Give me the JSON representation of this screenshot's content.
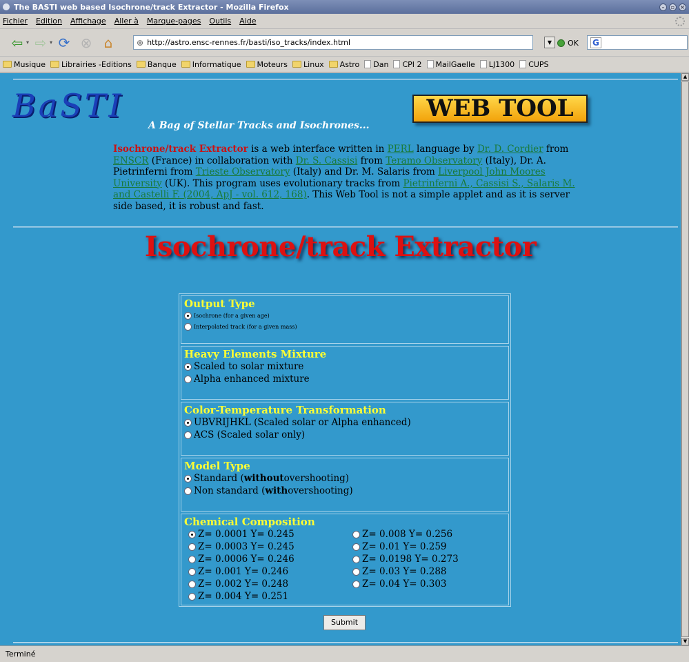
{
  "window": {
    "title": "The BASTI web based Isochrone/track Extractor - Mozilla Firefox"
  },
  "menu": [
    "Fichier",
    "Edition",
    "Affichage",
    "Aller à",
    "Marque-pages",
    "Outils",
    "Aide"
  ],
  "toolbar": {
    "url": "http://astro.ensc-rennes.fr/basti/iso_tracks/index.html",
    "ok_label": "OK"
  },
  "bookmarks": [
    {
      "label": "Musique",
      "icon": "folder-icon"
    },
    {
      "label": "Librairies -Editions",
      "icon": "folder-icon"
    },
    {
      "label": "Banque",
      "icon": "folder-icon"
    },
    {
      "label": "Informatique",
      "icon": "folder-icon"
    },
    {
      "label": "Moteurs",
      "icon": "folder-icon"
    },
    {
      "label": "Linux",
      "icon": "folder-icon"
    },
    {
      "label": "Astro",
      "icon": "folder-icon"
    },
    {
      "label": "Dan",
      "icon": "page-icon"
    },
    {
      "label": "CPI 2",
      "icon": "page-icon"
    },
    {
      "label": "MailGaelle",
      "icon": "page-icon"
    },
    {
      "label": "LJ1300",
      "icon": "page-icon"
    },
    {
      "label": "CUPS",
      "icon": "page-icon"
    }
  ],
  "page": {
    "logo": "BaSTI",
    "tagline": "A Bag of Stellar Tracks and Isochrones...",
    "web_tool": "WEB TOOL",
    "intro": {
      "title": "Isochrone/track Extractor",
      "t1": " is a web interface written in ",
      "l1": "PERL",
      "t2": " language by ",
      "l2": "Dr. D. Cordier",
      "t3": " from ",
      "l3": "ENSCR",
      "t4": " (France) in collaboration with ",
      "l4": "Dr. S. Cassisi",
      "t5": " from ",
      "l5": "Teramo Observatory",
      "t6": " (Italy), Dr. A. Pietrinferni from ",
      "l6": "Trieste Observatory",
      "t7": " (Italy) and Dr. M. Salaris from ",
      "l7": "Liverpool John Moores University",
      "t8": " (UK). This program uses evolutionary tracks from ",
      "l8": "Pietrinferni A., Cassisi S., Salaris M. and Castelli F. (2004, ApJ - vol. 612, 168)",
      "t9": ". This Web Tool is not a simple applet and as it is server side based, it is robust and fast."
    },
    "heading": "Isochrone/track Extractor"
  },
  "form": {
    "output_type": {
      "title": "Output Type",
      "options": [
        "Isochrone (for a given age)",
        "Interpolated track (for a given mass)"
      ],
      "selected": 0
    },
    "mixture": {
      "title": "Heavy Elements Mixture",
      "options": [
        "Scaled to solar mixture",
        "Alpha enhanced mixture"
      ],
      "selected": 0
    },
    "color_transform": {
      "title": "Color-Temperature Transformation",
      "options": [
        "UBVRIJHKL (Scaled solar or Alpha enhanced)",
        "ACS (Scaled solar only)"
      ],
      "selected": 0
    },
    "model_type": {
      "title": "Model Type",
      "opt1_pre": "Standard (",
      "opt1_bold": "without",
      "opt1_post": " overshooting)",
      "opt2_pre": "Non standard (",
      "opt2_bold": "with",
      "opt2_post": " overshooting)",
      "selected": 0
    },
    "composition": {
      "title": "Chemical Composition",
      "left": [
        "Z= 0.0001 Y= 0.245",
        "Z= 0.0003 Y= 0.245",
        "Z= 0.0006 Y= 0.246",
        "Z= 0.001 Y= 0.246",
        "Z= 0.002 Y= 0.248",
        "Z= 0.004 Y= 0.251"
      ],
      "right": [
        "Z= 0.008 Y= 0.256",
        "Z= 0.01 Y= 0.259",
        "Z= 0.0198 Y= 0.273",
        "Z= 0.03 Y= 0.288",
        "Z= 0.04 Y= 0.303"
      ],
      "selected": "Z= 0.0001 Y= 0.245"
    },
    "submit_label": "Submit"
  },
  "status": "Terminé"
}
